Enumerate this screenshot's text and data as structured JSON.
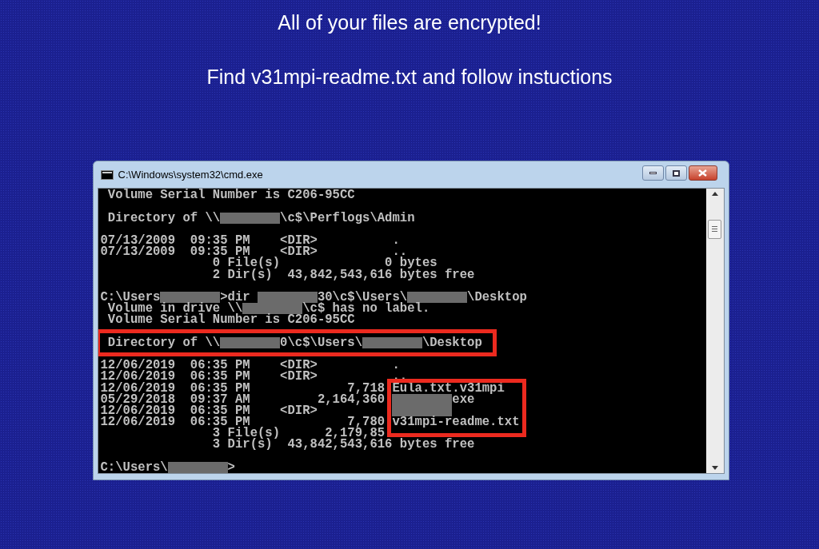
{
  "headline": "All of your files are encrypted!",
  "instruction": "Find v31mpi-readme.txt and follow instuctions",
  "window": {
    "title": "C:\\Windows\\system32\\cmd.exe"
  },
  "console": {
    "lines": [
      {
        "kind": "text",
        "segments": [
          {
            "kind": "text",
            "text": " Volume Serial Number is C206-95CC"
          }
        ]
      },
      {
        "kind": "blank"
      },
      {
        "kind": "text",
        "segments": [
          {
            "kind": "text",
            "text": " Directory of \\\\"
          },
          {
            "kind": "redacted"
          },
          {
            "kind": "text",
            "text": "\\c$\\Perflogs\\Admin"
          }
        ]
      },
      {
        "kind": "blank"
      },
      {
        "kind": "text",
        "segments": [
          {
            "kind": "text",
            "text": "07/13/2009  09:35 PM    <DIR>          ."
          }
        ]
      },
      {
        "kind": "text",
        "segments": [
          {
            "kind": "text",
            "text": "07/13/2009  09:35 PM    <DIR>          .."
          }
        ]
      },
      {
        "kind": "text",
        "segments": [
          {
            "kind": "text",
            "text": "               0 File(s)              0 bytes"
          }
        ]
      },
      {
        "kind": "text",
        "segments": [
          {
            "kind": "text",
            "text": "               2 Dir(s)  43,842,543,616 bytes free"
          }
        ]
      },
      {
        "kind": "blank"
      },
      {
        "kind": "text",
        "segments": [
          {
            "kind": "text",
            "text": "C:\\Users"
          },
          {
            "kind": "redacted"
          },
          {
            "kind": "text",
            "text": ">dir "
          },
          {
            "kind": "redacted"
          },
          {
            "kind": "text",
            "text": "30\\c$\\Users\\"
          },
          {
            "kind": "redacted"
          },
          {
            "kind": "text",
            "text": "\\Desktop"
          }
        ]
      },
      {
        "kind": "text",
        "segments": [
          {
            "kind": "text",
            "text": " Volume in drive \\\\"
          },
          {
            "kind": "redacted"
          },
          {
            "kind": "text",
            "text": "\\c$ has no label."
          }
        ]
      },
      {
        "kind": "text",
        "segments": [
          {
            "kind": "text",
            "text": " Volume Serial Number is C206-95CC"
          }
        ]
      },
      {
        "kind": "blank"
      },
      {
        "kind": "text",
        "highlighted": true,
        "segments": [
          {
            "kind": "text",
            "text": " Directory of \\\\"
          },
          {
            "kind": "redacted"
          },
          {
            "kind": "text",
            "text": "0\\c$\\Users\\"
          },
          {
            "kind": "redacted"
          },
          {
            "kind": "text",
            "text": "\\Desktop"
          }
        ]
      },
      {
        "kind": "blank"
      },
      {
        "kind": "text",
        "segments": [
          {
            "kind": "text",
            "text": "12/06/2019  06:35 PM    <DIR>          ."
          }
        ]
      },
      {
        "kind": "text",
        "segments": [
          {
            "kind": "text",
            "text": "12/06/2019  06:35 PM    <DIR>          .."
          }
        ]
      },
      {
        "kind": "text",
        "boxed": true,
        "segments": [
          {
            "kind": "text",
            "text": "12/06/2019  06:35 PM             7,718 Eula.txt.v31mpi"
          }
        ]
      },
      {
        "kind": "text",
        "boxed": true,
        "segments": [
          {
            "kind": "text",
            "text": "05/29/2018  09:37 AM         2,164,360 "
          },
          {
            "kind": "redacted"
          },
          {
            "kind": "text",
            "text": "exe"
          }
        ]
      },
      {
        "kind": "text",
        "boxed": true,
        "segments": [
          {
            "kind": "text",
            "text": "12/06/2019  06:35 PM    <DIR>          "
          },
          {
            "kind": "redacted"
          }
        ]
      },
      {
        "kind": "text",
        "boxed": true,
        "segments": [
          {
            "kind": "text",
            "text": "12/06/2019  06:35 PM             7,780 v31mpi-readme.txt"
          }
        ]
      },
      {
        "kind": "text",
        "segments": [
          {
            "kind": "text",
            "text": "               3 File(s)      2,179,85"
          }
        ]
      },
      {
        "kind": "text",
        "segments": [
          {
            "kind": "text",
            "text": "               3 Dir(s)  43,842,543,616 bytes free"
          }
        ]
      },
      {
        "kind": "blank"
      },
      {
        "kind": "text",
        "segments": [
          {
            "kind": "text",
            "text": "C:\\Users\\"
          },
          {
            "kind": "redacted"
          },
          {
            "kind": "text",
            "text": ">"
          }
        ]
      }
    ]
  }
}
